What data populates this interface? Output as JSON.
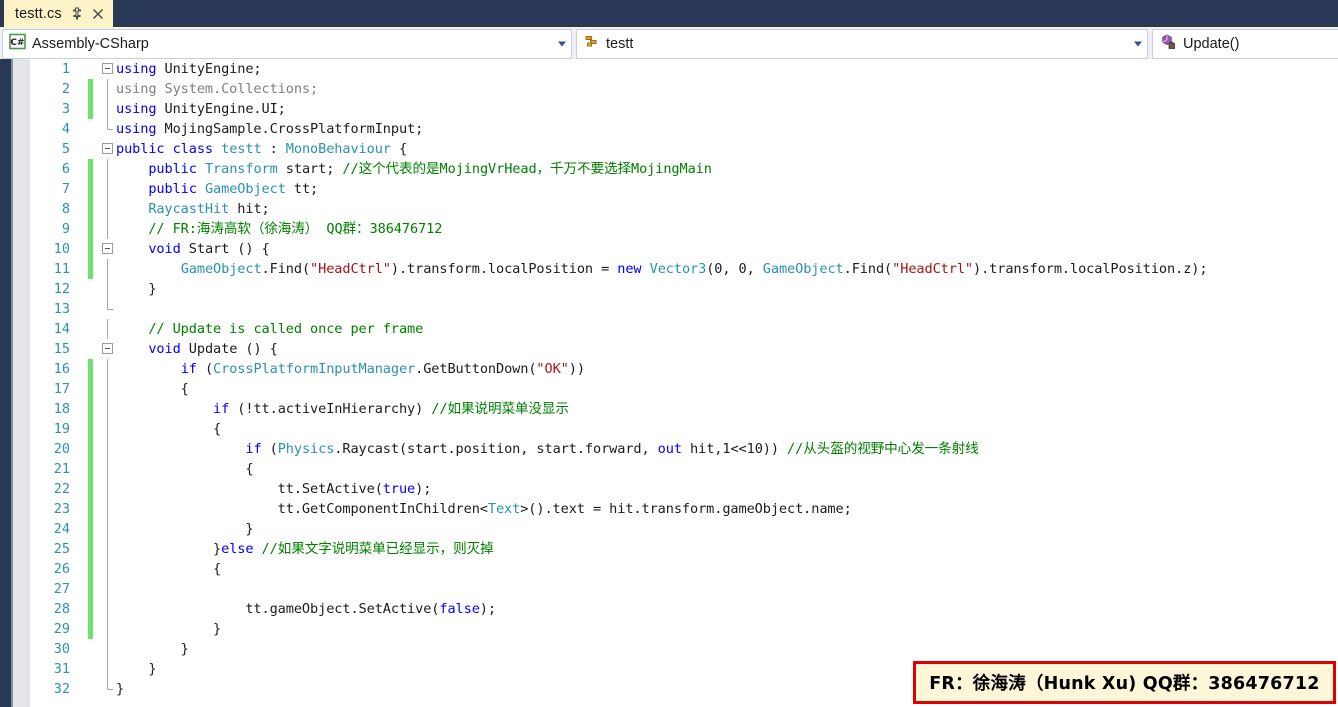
{
  "tab": {
    "title": "testt.cs",
    "pin_icon": "pin-icon",
    "close_icon": "close-icon"
  },
  "navbar": {
    "project": {
      "label": "Assembly-CSharp",
      "icon": "csharp-project-icon"
    },
    "type": {
      "label": "testt",
      "icon": "class-icon"
    },
    "member": {
      "label": "Update()",
      "icon": "method-private-icon"
    }
  },
  "editor": {
    "first_line": 1,
    "total_visible_lines": 32,
    "change_bar_ranges": [
      [
        2,
        3
      ],
      [
        6,
        11
      ],
      [
        16,
        29
      ]
    ],
    "lines": [
      {
        "n": 1,
        "outline": "collapse",
        "tokens": [
          {
            "c": "k",
            "v": "using"
          },
          {
            "c": "p",
            "v": " UnityEngine;"
          }
        ]
      },
      {
        "n": 2,
        "outline": "line",
        "tokens": [
          {
            "c": "cg",
            "v": "using System.Collections;"
          }
        ]
      },
      {
        "n": 3,
        "outline": "line",
        "tokens": [
          {
            "c": "k",
            "v": "using"
          },
          {
            "c": "p",
            "v": " UnityEngine.UI;"
          }
        ]
      },
      {
        "n": 4,
        "outline": "line-foot",
        "tokens": [
          {
            "c": "k",
            "v": "using"
          },
          {
            "c": "p",
            "v": " MojingSample.CrossPlatformInput;"
          }
        ]
      },
      {
        "n": 5,
        "outline": "collapse",
        "tokens": [
          {
            "c": "k",
            "v": "public class"
          },
          {
            "c": "p",
            "v": " "
          },
          {
            "c": "t",
            "v": "testt"
          },
          {
            "c": "p",
            "v": " : "
          },
          {
            "c": "t",
            "v": "MonoBehaviour"
          },
          {
            "c": "p",
            "v": " {"
          }
        ]
      },
      {
        "n": 6,
        "outline": "line",
        "tokens": [
          {
            "c": "p",
            "v": "    "
          },
          {
            "c": "k",
            "v": "public"
          },
          {
            "c": "p",
            "v": " "
          },
          {
            "c": "t",
            "v": "Transform"
          },
          {
            "c": "p",
            "v": " start; "
          },
          {
            "c": "cm",
            "v": "//这个代表的是MojingVrHead，千万不要选择MojingMain"
          }
        ]
      },
      {
        "n": 7,
        "outline": "line",
        "tokens": [
          {
            "c": "p",
            "v": "    "
          },
          {
            "c": "k",
            "v": "public"
          },
          {
            "c": "p",
            "v": " "
          },
          {
            "c": "t",
            "v": "GameObject"
          },
          {
            "c": "p",
            "v": " tt;"
          }
        ]
      },
      {
        "n": 8,
        "outline": "line",
        "tokens": [
          {
            "c": "p",
            "v": "    "
          },
          {
            "c": "t",
            "v": "RaycastHit"
          },
          {
            "c": "p",
            "v": " hit;"
          }
        ]
      },
      {
        "n": 9,
        "outline": "line",
        "tokens": [
          {
            "c": "p",
            "v": "    "
          },
          {
            "c": "cm",
            "v": "// FR:海涛高软（徐海涛） QQ群：386476712"
          }
        ]
      },
      {
        "n": 10,
        "outline": "collapse",
        "tokens": [
          {
            "c": "p",
            "v": "    "
          },
          {
            "c": "k",
            "v": "void"
          },
          {
            "c": "p",
            "v": " Start () {"
          }
        ]
      },
      {
        "n": 11,
        "outline": "line",
        "tokens": [
          {
            "c": "p",
            "v": "        "
          },
          {
            "c": "t",
            "v": "GameObject"
          },
          {
            "c": "p",
            "v": ".Find("
          },
          {
            "c": "s",
            "v": "\"HeadCtrl\""
          },
          {
            "c": "p",
            "v": ").transform.localPosition = "
          },
          {
            "c": "k",
            "v": "new"
          },
          {
            "c": "p",
            "v": " "
          },
          {
            "c": "t",
            "v": "Vector3"
          },
          {
            "c": "p",
            "v": "(0, 0, "
          },
          {
            "c": "t",
            "v": "GameObject"
          },
          {
            "c": "p",
            "v": ".Find("
          },
          {
            "c": "s",
            "v": "\"HeadCtrl\""
          },
          {
            "c": "p",
            "v": ").transform.localPosition.z);"
          }
        ]
      },
      {
        "n": 12,
        "outline": "line",
        "tokens": [
          {
            "c": "p",
            "v": "    }"
          }
        ]
      },
      {
        "n": 13,
        "outline": "line-foot",
        "tokens": []
      },
      {
        "n": 14,
        "outline": "line",
        "tokens": [
          {
            "c": "p",
            "v": "    "
          },
          {
            "c": "cm",
            "v": "// Update is called once per frame"
          }
        ]
      },
      {
        "n": 15,
        "outline": "collapse",
        "tokens": [
          {
            "c": "p",
            "v": "    "
          },
          {
            "c": "k",
            "v": "void"
          },
          {
            "c": "p",
            "v": " Update () {"
          }
        ]
      },
      {
        "n": 16,
        "outline": "line",
        "tokens": [
          {
            "c": "p",
            "v": "        "
          },
          {
            "c": "k",
            "v": "if"
          },
          {
            "c": "p",
            "v": " ("
          },
          {
            "c": "t",
            "v": "CrossPlatformInputManager"
          },
          {
            "c": "p",
            "v": ".GetButtonDown("
          },
          {
            "c": "s",
            "v": "\"OK\""
          },
          {
            "c": "p",
            "v": "))"
          }
        ]
      },
      {
        "n": 17,
        "outline": "line",
        "tokens": [
          {
            "c": "p",
            "v": "        {"
          }
        ]
      },
      {
        "n": 18,
        "outline": "line",
        "tokens": [
          {
            "c": "p",
            "v": "            "
          },
          {
            "c": "k",
            "v": "if"
          },
          {
            "c": "p",
            "v": " (!tt.activeInHierarchy) "
          },
          {
            "c": "cm",
            "v": "//如果说明菜单没显示"
          }
        ]
      },
      {
        "n": 19,
        "outline": "line",
        "tokens": [
          {
            "c": "p",
            "v": "            {"
          }
        ]
      },
      {
        "n": 20,
        "outline": "line",
        "tokens": [
          {
            "c": "p",
            "v": "                "
          },
          {
            "c": "k",
            "v": "if"
          },
          {
            "c": "p",
            "v": " ("
          },
          {
            "c": "t",
            "v": "Physics"
          },
          {
            "c": "p",
            "v": ".Raycast(start.position, start.forward, "
          },
          {
            "c": "k",
            "v": "out"
          },
          {
            "c": "p",
            "v": " hit,1<<10)) "
          },
          {
            "c": "cm",
            "v": "//从头盔的视野中心发一条射线"
          }
        ]
      },
      {
        "n": 21,
        "outline": "line",
        "tokens": [
          {
            "c": "p",
            "v": "                {"
          }
        ]
      },
      {
        "n": 22,
        "outline": "line",
        "tokens": [
          {
            "c": "p",
            "v": "                    tt.SetActive("
          },
          {
            "c": "k",
            "v": "true"
          },
          {
            "c": "p",
            "v": ");"
          }
        ]
      },
      {
        "n": 23,
        "outline": "line",
        "tokens": [
          {
            "c": "p",
            "v": "                    tt.GetComponentInChildren<"
          },
          {
            "c": "t",
            "v": "Text"
          },
          {
            "c": "p",
            "v": ">().text = hit.transform.gameObject.name;"
          }
        ]
      },
      {
        "n": 24,
        "outline": "line",
        "tokens": [
          {
            "c": "p",
            "v": "                }"
          }
        ]
      },
      {
        "n": 25,
        "outline": "line",
        "tokens": [
          {
            "c": "p",
            "v": "            }"
          },
          {
            "c": "k",
            "v": "else"
          },
          {
            "c": "p",
            "v": " "
          },
          {
            "c": "cm",
            "v": "//如果文字说明菜单已经显示，则灭掉"
          }
        ]
      },
      {
        "n": 26,
        "outline": "line",
        "tokens": [
          {
            "c": "p",
            "v": "            {"
          }
        ]
      },
      {
        "n": 27,
        "outline": "line",
        "tokens": []
      },
      {
        "n": 28,
        "outline": "line",
        "tokens": [
          {
            "c": "p",
            "v": "                tt.gameObject.SetActive("
          },
          {
            "c": "k",
            "v": "false"
          },
          {
            "c": "p",
            "v": ");"
          }
        ]
      },
      {
        "n": 29,
        "outline": "line",
        "tokens": [
          {
            "c": "p",
            "v": "            }"
          }
        ]
      },
      {
        "n": 30,
        "outline": "line",
        "tokens": [
          {
            "c": "p",
            "v": "        }"
          }
        ]
      },
      {
        "n": 31,
        "outline": "line",
        "tokens": [
          {
            "c": "p",
            "v": "    }"
          }
        ]
      },
      {
        "n": 32,
        "outline": "line-foot",
        "tokens": [
          {
            "c": "p",
            "v": "}"
          }
        ]
      }
    ]
  },
  "watermark": {
    "text": "FR：徐海涛（Hunk Xu) QQ群：386476712",
    "border_color": "#e00000",
    "background_color": "#fdf6d8"
  },
  "colors": {
    "tab_active_bg": "#fdf3c8",
    "tabstrip_bg": "#293955",
    "navbar_bg": "#eef1f7",
    "keyword": "#0000ff",
    "type": "#2b91af",
    "string": "#a31515",
    "comment": "#008000",
    "grayed": "#808080",
    "linenumber": "#2b91af",
    "changebar": "#6ee06e"
  }
}
